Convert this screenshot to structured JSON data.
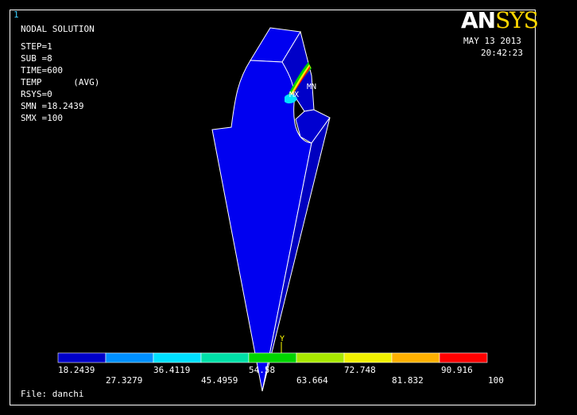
{
  "window": {
    "number": "1"
  },
  "header": {
    "title": "NODAL SOLUTION",
    "lines": [
      "STEP=1",
      "SUB =8",
      "TIME=600",
      "TEMP      (AVG)",
      "RSYS=0",
      "SMN =18.2439",
      "SMX =100"
    ]
  },
  "logo": {
    "part1": "AN",
    "part2": "SYS"
  },
  "timestamp": {
    "date": "MAY 13 2013",
    "time": "20:42:23"
  },
  "markers": {
    "min": "MN",
    "max": "MX",
    "axis_y": "Y"
  },
  "colors": {
    "background": "#000000",
    "model_fill": "#0000ff",
    "model_edge": "#ffffff",
    "scale": [
      "#0000c8",
      "#0090ff",
      "#00e0ff",
      "#00e0a8",
      "#00d400",
      "#a8e800",
      "#f0f000",
      "#ffb000",
      "#ff0000"
    ]
  },
  "legend": {
    "labels_top": [
      "18.2439",
      "36.4119",
      "54.58",
      "72.748",
      "90.916"
    ],
    "labels_bottom": [
      "27.3279",
      "45.4959",
      "63.664",
      "81.832",
      "100"
    ]
  },
  "footer": {
    "file_label": "File: danchi"
  }
}
